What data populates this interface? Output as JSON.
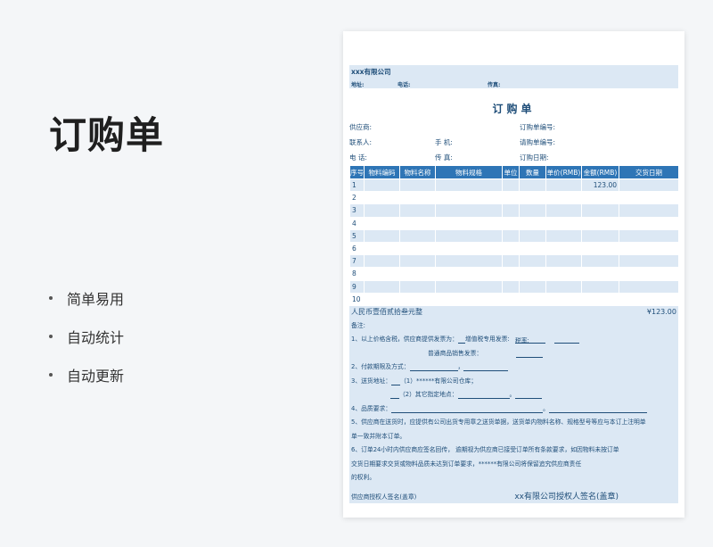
{
  "title": "订购单",
  "features": [
    "简单易用",
    "自动统计",
    "自动更新"
  ],
  "doc": {
    "company": "xxx有限公司",
    "addr_label": "地址:",
    "tel_label": "电话:",
    "fax_label": "传真:",
    "form_title": "订购单",
    "supplier_label": "供应商:",
    "order_no_label": "订购单编号:",
    "contact_label": "联系人:",
    "mobile_label": "手  机:",
    "request_no_label": "请购单编号:",
    "phone_label": "电  话:",
    "fax2_label": "传  真:",
    "order_date_label": "订购日期:",
    "columns": [
      "序号",
      "物料编码",
      "物料名称",
      "物料规格",
      "单位",
      "数量",
      "单价(RMB)",
      "金额(RMB)",
      "交货日期"
    ],
    "rows": [
      {
        "no": "1",
        "amount": "123.00"
      },
      {
        "no": "2",
        "amount": ""
      },
      {
        "no": "3",
        "amount": ""
      },
      {
        "no": "4",
        "amount": ""
      },
      {
        "no": "5",
        "amount": ""
      },
      {
        "no": "6",
        "amount": ""
      },
      {
        "no": "7",
        "amount": ""
      },
      {
        "no": "8",
        "amount": ""
      },
      {
        "no": "9",
        "amount": ""
      },
      {
        "no": "10",
        "amount": ""
      }
    ],
    "total_words": "人民币壹佰贰拾叁元整",
    "total_amount": "¥123.00",
    "notes_title": "备注:",
    "note1": "1、以上价格含税，供应商提供发票为：",
    "note1_vat": "增值税专用发票:",
    "note1_rate": "税率:",
    "note1_general": "普通商品销售发票：",
    "note2": "2、付款期限及方式：",
    "note3": "3、送货地址：",
    "note3_opt1": "（1）******有限公司仓库；",
    "note3_opt2": "（2）其它指定地点：",
    "note4": "4、品质要求：",
    "note5a": "5、供应商在送货时，应提供有公司出货专用章之送货单据，送货单内物料名称、规格型号等应与本订上注明单",
    "note5b": "单一致并附本订单。",
    "note6a": "6、订单24小时内供应商应签名回传， 逾期视为供应商已接受订单所有条款要求，如因物料未按订单",
    "note6b": "交货日期要求交货或物料品质未达到订单要求，******有限公司将保留追究供应商责任",
    "note6c": "的权利。",
    "sign_supplier": "供应商授权人签名(盖章)",
    "sign_company": "xx有限公司授权人签名(盖章)",
    "period": "。",
    "comma": "，"
  },
  "colors": {
    "header_blue": "#2e75b6",
    "band": "#dce8f4",
    "text_blue": "#1f4e79"
  }
}
